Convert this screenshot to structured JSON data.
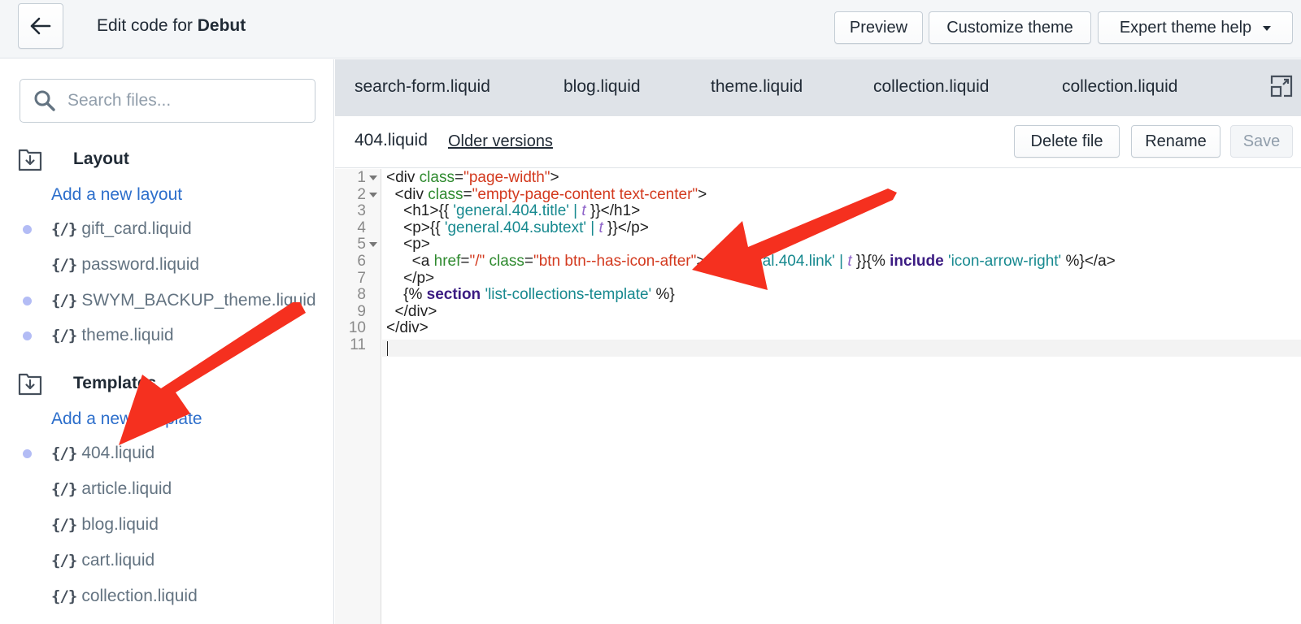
{
  "header": {
    "title_prefix": "Edit code for ",
    "theme_name": "Debut",
    "preview_label": "Preview",
    "customize_label": "Customize theme",
    "help_label": "Expert theme help"
  },
  "sidebar": {
    "search_placeholder": "Search files...",
    "layout": {
      "title": "Layout",
      "add_label": "Add a new layout",
      "files": [
        {
          "name": "gift_card.liquid",
          "modified": true
        },
        {
          "name": "password.liquid",
          "modified": false
        },
        {
          "name": "SWYM_BACKUP_theme.liquid",
          "modified": true
        },
        {
          "name": "theme.liquid",
          "modified": true
        }
      ]
    },
    "templates": {
      "title": "Templates",
      "add_label": "Add a new template",
      "files": [
        {
          "name": "404.liquid",
          "modified": true
        },
        {
          "name": "article.liquid",
          "modified": false
        },
        {
          "name": "blog.liquid",
          "modified": false
        },
        {
          "name": "cart.liquid",
          "modified": false
        },
        {
          "name": "collection.liquid",
          "modified": false
        }
      ]
    }
  },
  "tabs": [
    "search-form.liquid",
    "blog.liquid",
    "theme.liquid",
    "collection.liquid",
    "collection.liquid"
  ],
  "file": {
    "name": "404.liquid",
    "older_versions_label": "Older versions",
    "delete_label": "Delete file",
    "rename_label": "Rename",
    "save_label": "Save"
  },
  "code": {
    "line_numbers": [
      "1",
      "2",
      "3",
      "4",
      "5",
      "6",
      "7",
      "8",
      "9",
      "10",
      "11"
    ],
    "lines": [
      [
        [
          "t",
          "<div "
        ],
        [
          "a",
          "class"
        ],
        [
          "t",
          "="
        ],
        [
          "s",
          "\"page-width\""
        ],
        [
          "t",
          ">"
        ]
      ],
      [
        [
          "t",
          "  <div "
        ],
        [
          "a",
          "class"
        ],
        [
          "t",
          "="
        ],
        [
          "s",
          "\"empty-page-content text-center\""
        ],
        [
          "t",
          ">"
        ]
      ],
      [
        [
          "t",
          "    <h1>{{ "
        ],
        [
          "l",
          "'general.404.title'"
        ],
        [
          "t",
          " "
        ],
        [
          "l",
          "|"
        ],
        [
          "t",
          " "
        ],
        [
          "f",
          "t"
        ],
        [
          "t",
          " }}</h1>"
        ]
      ],
      [
        [
          "t",
          "    <p>{{ "
        ],
        [
          "l",
          "'general.404.subtext'"
        ],
        [
          "t",
          " "
        ],
        [
          "l",
          "|"
        ],
        [
          "t",
          " "
        ],
        [
          "f",
          "t"
        ],
        [
          "t",
          " }}</p>"
        ]
      ],
      [
        [
          "t",
          "    <p>"
        ]
      ],
      [
        [
          "t",
          "      <a "
        ],
        [
          "a",
          "href"
        ],
        [
          "t",
          "="
        ],
        [
          "s",
          "\"/\""
        ],
        [
          "t",
          " "
        ],
        [
          "a",
          "class"
        ],
        [
          "t",
          "="
        ],
        [
          "s",
          "\"btn btn--has-icon-after\""
        ],
        [
          "t",
          ">{{ "
        ],
        [
          "l",
          "'general.404.link'"
        ],
        [
          "t",
          " "
        ],
        [
          "l",
          "|"
        ],
        [
          "t",
          " "
        ],
        [
          "f",
          "t"
        ],
        [
          "t",
          " }}{% "
        ],
        [
          "k",
          "include"
        ],
        [
          "t",
          " "
        ],
        [
          "l",
          "'icon-arrow-right'"
        ],
        [
          "t",
          " %}</a>"
        ]
      ],
      [
        [
          "t",
          "    </p>"
        ]
      ],
      [
        [
          "t",
          "    {% "
        ],
        [
          "k",
          "section"
        ],
        [
          "t",
          " "
        ],
        [
          "l",
          "'list-collections-template'"
        ],
        [
          "t",
          " %}"
        ]
      ],
      [
        [
          "t",
          "  </div>"
        ]
      ],
      [
        [
          "t",
          "</div>"
        ]
      ],
      [
        [
          "t",
          ""
        ]
      ]
    ]
  },
  "colors": {
    "link": "#2c6ecb",
    "arrow": "#f5301f",
    "modified_dot": "#b3bcf5"
  }
}
